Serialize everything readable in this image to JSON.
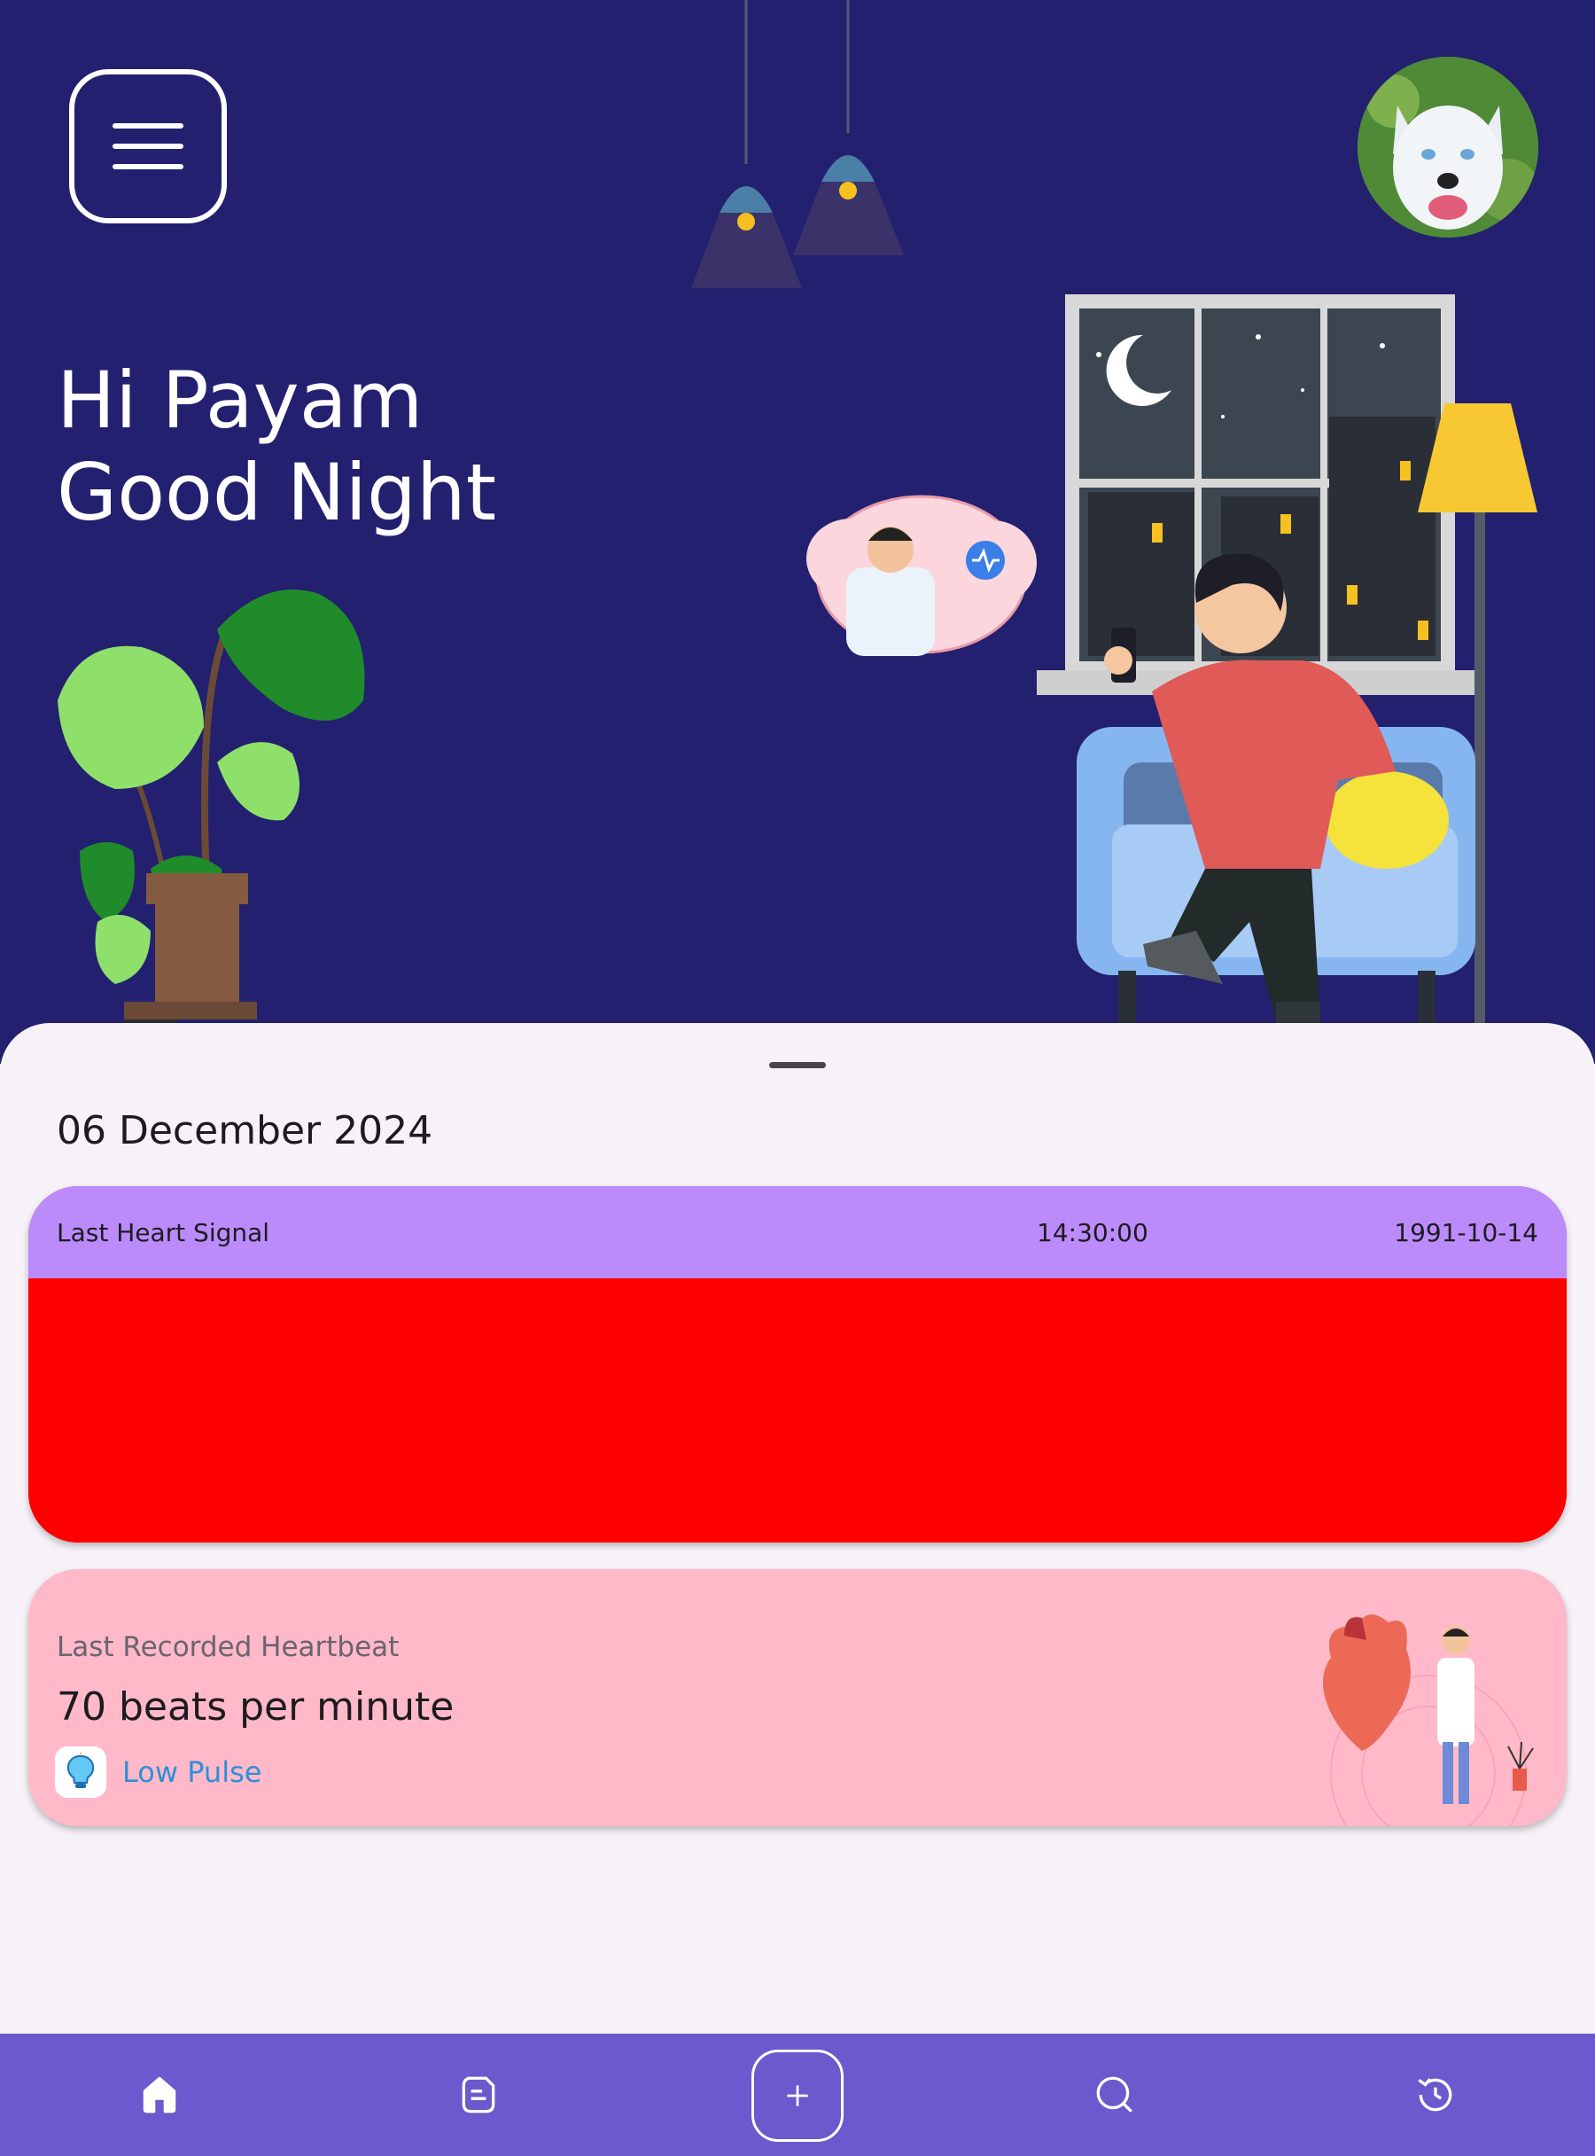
{
  "header": {
    "greeting_line1": "Hi Payam",
    "greeting_line2": "Good Night",
    "menu_icon": "hamburger-menu-icon",
    "avatar": "profile-avatar-dog"
  },
  "sheet": {
    "date": "06 December 2024",
    "signal_card": {
      "label": "Last Heart Signal",
      "time": "14:30:00",
      "date": "1991-10-14",
      "header_color": "#bb8bfb",
      "body_color": "#ff0000"
    },
    "heartbeat_card": {
      "caption": "Last Recorded Heartbeat",
      "value": "70 beats per minute",
      "status": "Low Pulse",
      "status_icon": "lightbulb-icon",
      "background_color": "#ffb9c8",
      "status_color": "#2f8fd8"
    }
  },
  "bottom_nav": {
    "background_color": "#6a5acd",
    "items": [
      {
        "icon": "home-icon",
        "active": true
      },
      {
        "icon": "notes-icon",
        "active": false
      },
      {
        "icon": "plus-icon",
        "active": false
      },
      {
        "icon": "search-icon",
        "active": false
      },
      {
        "icon": "history-icon",
        "active": false
      }
    ]
  },
  "colors": {
    "hero_background": "#232070",
    "sheet_background": "#f6f2f8"
  }
}
